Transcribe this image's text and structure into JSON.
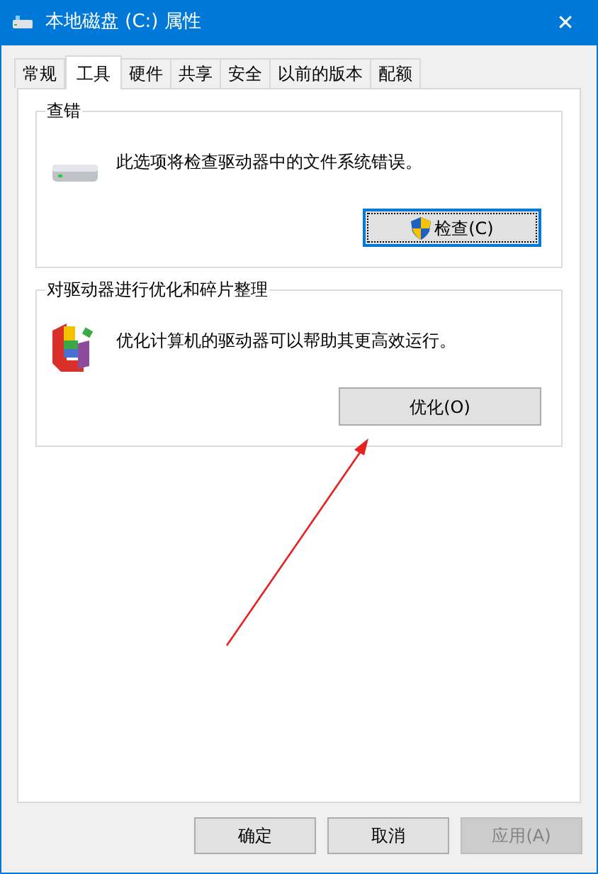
{
  "window": {
    "title": "本地磁盘 (C:) 属性",
    "close": "✕"
  },
  "tabs": [
    {
      "label": "常规",
      "selected": false
    },
    {
      "label": "工具",
      "selected": true
    },
    {
      "label": "硬件",
      "selected": false
    },
    {
      "label": "共享",
      "selected": false
    },
    {
      "label": "安全",
      "selected": false
    },
    {
      "label": "以前的版本",
      "selected": false
    },
    {
      "label": "配额",
      "selected": false
    }
  ],
  "groups": [
    {
      "kind": "check",
      "title": "查错",
      "description": "此选项将检查驱动器中的文件系统错误。",
      "button": {
        "label": "检查(C)",
        "focused": true,
        "shield": true
      }
    },
    {
      "kind": "defrag",
      "title": "对驱动器进行优化和碎片整理",
      "description": "优化计算机的驱动器可以帮助其更高效运行。",
      "button": {
        "label": "优化(O)",
        "focused": false,
        "shield": false
      }
    }
  ],
  "buttons": [
    {
      "label": "确定",
      "disabled": false
    },
    {
      "label": "取消",
      "disabled": false
    },
    {
      "label": "应用(A)",
      "disabled": true
    }
  ]
}
